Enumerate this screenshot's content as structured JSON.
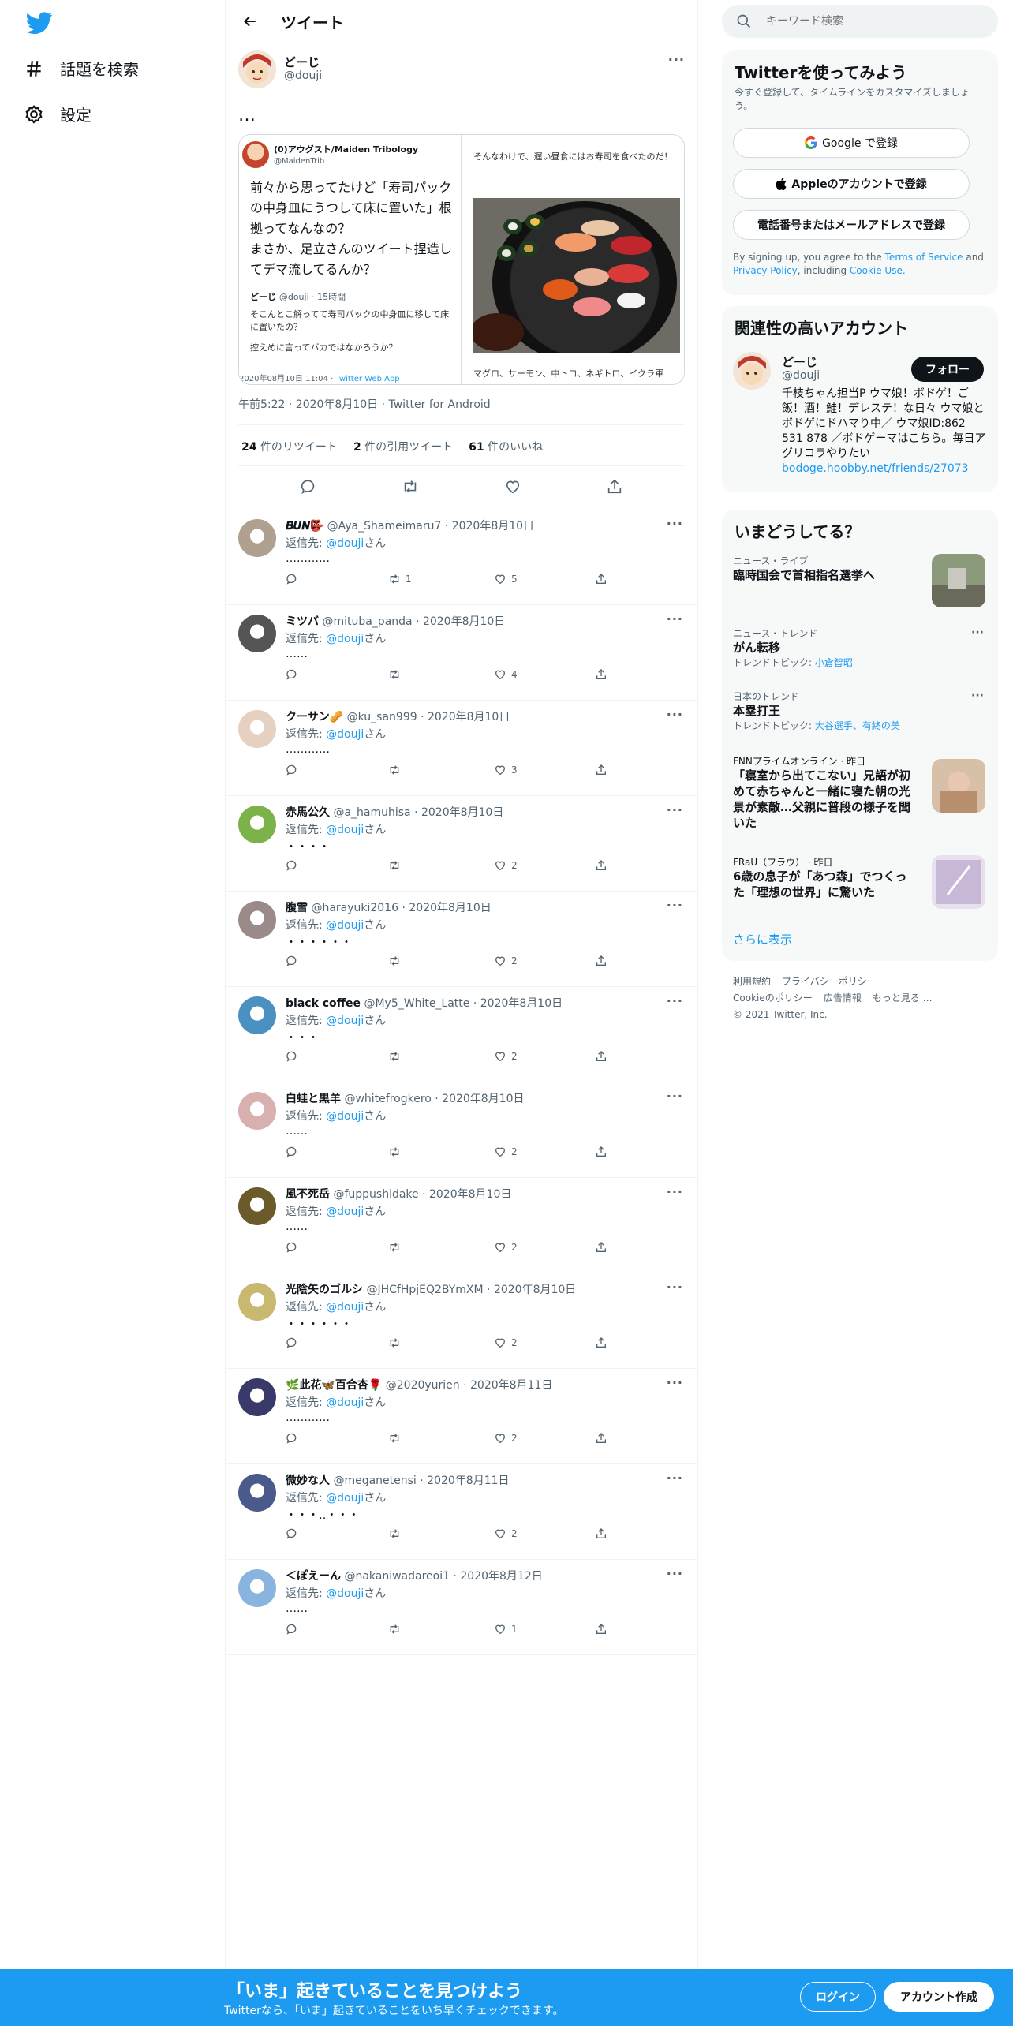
{
  "nav": {
    "explore_label": "話題を検索",
    "settings_label": "設定"
  },
  "header": {
    "title": "ツイート"
  },
  "tweet": {
    "name": "どーじ",
    "handle": "@douji",
    "text": "…",
    "quoted": {
      "name": "(0)アウグスト/Maiden Tribology",
      "handle": "@MaidenTrib",
      "body": "前々から思ってたけど「寿司パックの中身皿にうつして床に置いた」根拠ってなんなの？\nまさか、足立さんのツイート捏造してデマ流してるんか？",
      "inner_name": "どーじ",
      "inner_meta": "@douji · 15時間",
      "inner_text1": "そこんとこ解ってて寿司パックの中身皿に移して床に置いたの？",
      "inner_text2": "控えめに言ってバカではなかろうか？",
      "footer_date": "2020年08月10日 11:04 · ",
      "footer_app": "Twitter Web App"
    },
    "right_text": "そんなわけで、遅い昼食にはお寿司を食べたのだ！",
    "right_caption": "マグロ、サーモン、中トロ、ネギトロ、イクラ軍",
    "timestamp": "午前5:22 · 2020年8月10日 · Twitter for Android",
    "retweets": "24",
    "retweets_label": "件のリツイート",
    "quotes": "2",
    "quotes_label": "件の引用ツイート",
    "likes": "61",
    "likes_label": "件のいいね"
  },
  "replies": [
    {
      "name": "𝑩𝑼𝑵👺",
      "handle": "@Aya_Shameimaru7 · 2020年8月10日",
      "to": "返信先: ",
      "mention": "@douji",
      "san": "さん",
      "text": "…………",
      "rt": "1",
      "like": "5",
      "color": "#b0a090"
    },
    {
      "name": "ミツバ",
      "handle": "@mituba_panda · 2020年8月10日",
      "to": "返信先: ",
      "mention": "@douji",
      "san": "さん",
      "text": "……",
      "rt": "",
      "like": "4",
      "color": "#555"
    },
    {
      "name": "クーサン🥜",
      "handle": "@ku_san999 · 2020年8月10日",
      "to": "返信先: ",
      "mention": "@douji",
      "san": "さん",
      "text": "…………",
      "rt": "",
      "like": "3",
      "color": "#e6d0c0"
    },
    {
      "name": "赤馬公久",
      "handle": "@a_hamuhisa · 2020年8月10日",
      "to": "返信先: ",
      "mention": "@douji",
      "san": "さん",
      "text": "・・・・",
      "rt": "",
      "like": "2",
      "color": "#7bb34a"
    },
    {
      "name": "腹雪",
      "handle": "@harayuki2016 · 2020年8月10日",
      "to": "返信先: ",
      "mention": "@douji",
      "san": "さん",
      "text": "・・・・・・",
      "rt": "",
      "like": "2",
      "color": "#9a8a8a"
    },
    {
      "name": "black coffee",
      "handle": "@My5_White_Latte · 2020年8月10日",
      "to": "返信先: ",
      "mention": "@douji",
      "san": "さん",
      "text": "・・・",
      "rt": "",
      "like": "2",
      "color": "#4a90c0"
    },
    {
      "name": "白蛙と黒羊",
      "handle": "@whitefrogkero · 2020年8月10日",
      "to": "返信先: ",
      "mention": "@douji",
      "san": "さん",
      "text": "……",
      "rt": "",
      "like": "2",
      "color": "#d8b0b0"
    },
    {
      "name": "風不死岳",
      "handle": "@fuppushidake · 2020年8月10日",
      "to": "返信先: ",
      "mention": "@douji",
      "san": "さん",
      "text": "……",
      "rt": "",
      "like": "2",
      "color": "#6b5a2a"
    },
    {
      "name": "光陰矢のゴルシ",
      "handle": "@JHCfHpjEQ2BYmXM · 2020年8月10日",
      "to": "返信先: ",
      "mention": "@douji",
      "san": "さん",
      "text": "・・・・・・",
      "rt": "",
      "like": "2",
      "color": "#c8b870"
    },
    {
      "name": "🌿此花🦋百合杏🌹",
      "handle": "@2020yurien · 2020年8月11日",
      "to": "返信先: ",
      "mention": "@douji",
      "san": "さん",
      "text": "…………",
      "rt": "",
      "like": "2",
      "color": "#3a3a6a"
    },
    {
      "name": "微妙な人",
      "handle": "@meganetensi · 2020年8月11日",
      "to": "返信先: ",
      "mention": "@douji",
      "san": "さん",
      "text": "・・・‥・・・",
      "rt": "",
      "like": "2",
      "color": "#4a5a8a"
    },
    {
      "name": "＜ぽえーん",
      "handle": "@nakaniwadareoi1 · 2020年8月12日",
      "to": "返信先: ",
      "mention": "@douji",
      "san": "さん",
      "text": "……",
      "rt": "",
      "like": "1",
      "color": "#8ab4e0"
    }
  ],
  "search": {
    "placeholder": "キーワード検索"
  },
  "signup": {
    "title": "Twitterを使ってみよう",
    "sub": "今すぐ登録して、タイムラインをカスタマイズしましょう。",
    "google": "Google で登録",
    "apple": "Appleのアカウントで登録",
    "phone": "電話番号またはメールアドレスで登録",
    "terms1": "By signing up, you agree to the ",
    "terms_tos": "Terms of Service",
    "terms2": " and ",
    "terms_pp": "Privacy Policy",
    "terms3": ", including ",
    "terms_cookie": "Cookie Use."
  },
  "related": {
    "title": "関連性の高いアカウント",
    "name": "どーじ",
    "handle": "@douji",
    "follow": "フォロー",
    "bio": "千枝ちゃん担当P ウマ娘！ボドゲ！ご飯！酒！鮭！デレステ！な日々 ウマ娘とボドゲにドハマり中／ ウマ娘ID:862 531 878 ／ボドゲーマはこちら。毎日アグリコラやりたい",
    "link": "bodoge.hoobby.net/friends/27073"
  },
  "trends": {
    "title": "いまどうしてる？",
    "items": [
      {
        "cat": "ニュース・ライブ",
        "title": "臨時国会で首相指名選挙へ",
        "topic_label": "",
        "topic": ""
      },
      {
        "cat": "ニュース・トレンド",
        "title": "がん転移",
        "topic_label": "トレンドトピック: ",
        "topic": "小倉智昭"
      },
      {
        "cat": "日本のトレンド",
        "title": "本塁打王",
        "topic_label": "トレンドトピック: ",
        "topic": "大谷選手、有終の美"
      },
      {
        "cat": "FNNプライムオンライン · 昨日",
        "title": "「寝室から出てこない」兄語が初めて赤ちゃんと一緒に寝た朝の光景が素敵…父親に普段の様子を聞いた",
        "topic_label": "",
        "topic": ""
      },
      {
        "cat": "FRaU（フラウ） · 昨日",
        "title": "6歳の息子が「あつ森」でつくった「理想の世界」に驚いた",
        "topic_label": "",
        "topic": ""
      }
    ],
    "show_more": "さらに表示"
  },
  "footer": {
    "terms": "利用規約",
    "privacy": "プライバシーポリシー",
    "cookie": "Cookieのポリシー",
    "ads": "広告情報",
    "more": "もっと見る …",
    "copy": "© 2021 Twitter, Inc."
  },
  "bottom": {
    "headline": "「いま」起きていることを見つけよう",
    "sub": "Twitterなら、「いま」起きていることをいち早くチェックできます。",
    "login": "ログイン",
    "signup": "アカウント作成"
  },
  "colors": {
    "accent": "#1d9bf0",
    "text": "#0f1419",
    "muted": "#536471"
  }
}
